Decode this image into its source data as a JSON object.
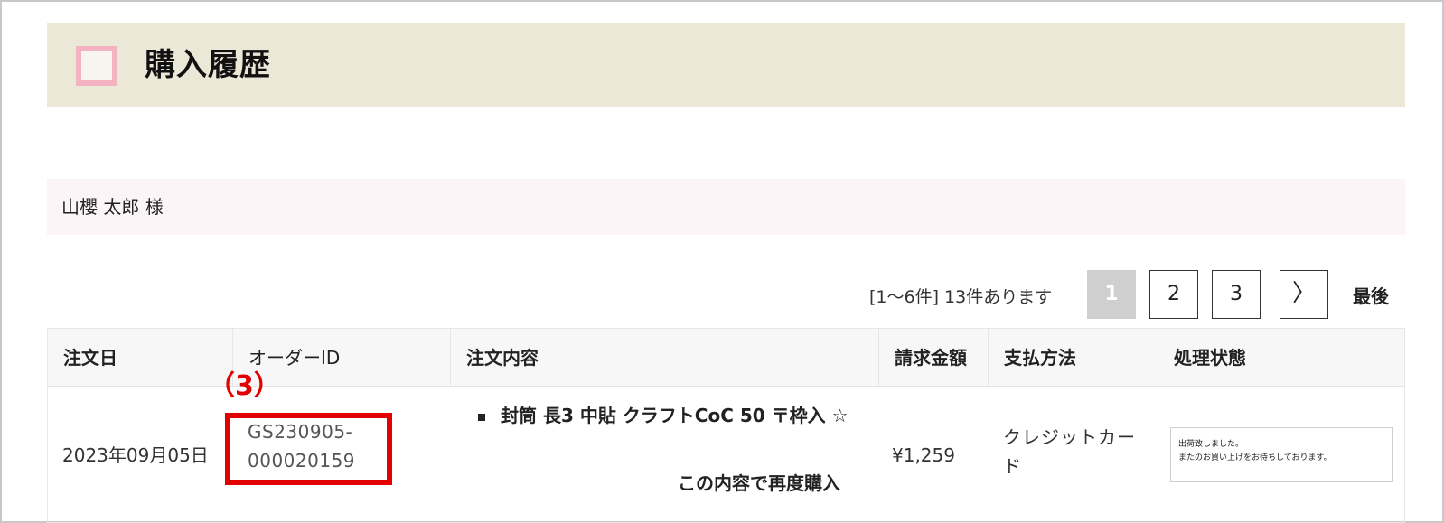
{
  "header": {
    "title": "購入履歴"
  },
  "customer": {
    "name": "山櫻 太郎 様"
  },
  "pagination": {
    "count_text": "[1〜6件] 13件あります",
    "pages": [
      "1",
      "2",
      "3"
    ],
    "next": "〉",
    "last": "最後"
  },
  "table": {
    "headers": {
      "date": "注文日",
      "order_id": "オーダーID",
      "content": "注文内容",
      "amount": "請求金額",
      "payment": "支払方法",
      "status": "処理状態"
    },
    "rows": [
      {
        "date": "2023年09月05日",
        "order_id": "GS230905-000020159",
        "item": "封筒 長3 中貼 クラフトCoC 50 〒枠入 ☆",
        "rebuy": "この内容で再度購入",
        "amount": "¥1,259",
        "payment": "クレジットカード",
        "status_line1": "出荷致しました。",
        "status_line2": "またのお買い上げをお待ちしております。"
      }
    ]
  },
  "annotation": {
    "label": "（3）",
    "color": "#e30000"
  },
  "colors": {
    "title_bg": "#ece8d7",
    "name_bg": "#fcf5f7",
    "accent_square": "#f3b3c0"
  }
}
